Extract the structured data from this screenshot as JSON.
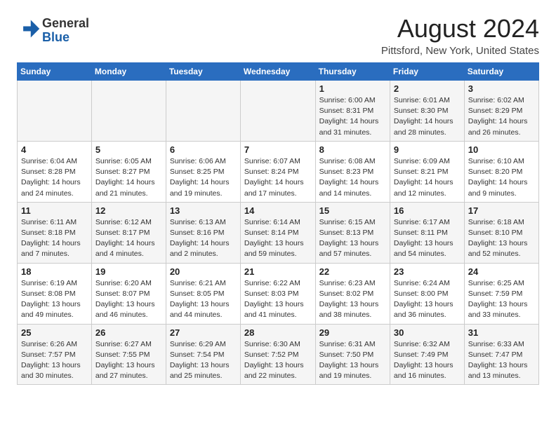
{
  "logo": {
    "general": "General",
    "blue": "Blue"
  },
  "title": "August 2024",
  "location": "Pittsford, New York, United States",
  "days_of_week": [
    "Sunday",
    "Monday",
    "Tuesday",
    "Wednesday",
    "Thursday",
    "Friday",
    "Saturday"
  ],
  "weeks": [
    [
      {
        "day": "",
        "info": ""
      },
      {
        "day": "",
        "info": ""
      },
      {
        "day": "",
        "info": ""
      },
      {
        "day": "",
        "info": ""
      },
      {
        "day": "1",
        "info": "Sunrise: 6:00 AM\nSunset: 8:31 PM\nDaylight: 14 hours and 31 minutes."
      },
      {
        "day": "2",
        "info": "Sunrise: 6:01 AM\nSunset: 8:30 PM\nDaylight: 14 hours and 28 minutes."
      },
      {
        "day": "3",
        "info": "Sunrise: 6:02 AM\nSunset: 8:29 PM\nDaylight: 14 hours and 26 minutes."
      }
    ],
    [
      {
        "day": "4",
        "info": "Sunrise: 6:04 AM\nSunset: 8:28 PM\nDaylight: 14 hours and 24 minutes."
      },
      {
        "day": "5",
        "info": "Sunrise: 6:05 AM\nSunset: 8:27 PM\nDaylight: 14 hours and 21 minutes."
      },
      {
        "day": "6",
        "info": "Sunrise: 6:06 AM\nSunset: 8:25 PM\nDaylight: 14 hours and 19 minutes."
      },
      {
        "day": "7",
        "info": "Sunrise: 6:07 AM\nSunset: 8:24 PM\nDaylight: 14 hours and 17 minutes."
      },
      {
        "day": "8",
        "info": "Sunrise: 6:08 AM\nSunset: 8:23 PM\nDaylight: 14 hours and 14 minutes."
      },
      {
        "day": "9",
        "info": "Sunrise: 6:09 AM\nSunset: 8:21 PM\nDaylight: 14 hours and 12 minutes."
      },
      {
        "day": "10",
        "info": "Sunrise: 6:10 AM\nSunset: 8:20 PM\nDaylight: 14 hours and 9 minutes."
      }
    ],
    [
      {
        "day": "11",
        "info": "Sunrise: 6:11 AM\nSunset: 8:18 PM\nDaylight: 14 hours and 7 minutes."
      },
      {
        "day": "12",
        "info": "Sunrise: 6:12 AM\nSunset: 8:17 PM\nDaylight: 14 hours and 4 minutes."
      },
      {
        "day": "13",
        "info": "Sunrise: 6:13 AM\nSunset: 8:16 PM\nDaylight: 14 hours and 2 minutes."
      },
      {
        "day": "14",
        "info": "Sunrise: 6:14 AM\nSunset: 8:14 PM\nDaylight: 13 hours and 59 minutes."
      },
      {
        "day": "15",
        "info": "Sunrise: 6:15 AM\nSunset: 8:13 PM\nDaylight: 13 hours and 57 minutes."
      },
      {
        "day": "16",
        "info": "Sunrise: 6:17 AM\nSunset: 8:11 PM\nDaylight: 13 hours and 54 minutes."
      },
      {
        "day": "17",
        "info": "Sunrise: 6:18 AM\nSunset: 8:10 PM\nDaylight: 13 hours and 52 minutes."
      }
    ],
    [
      {
        "day": "18",
        "info": "Sunrise: 6:19 AM\nSunset: 8:08 PM\nDaylight: 13 hours and 49 minutes."
      },
      {
        "day": "19",
        "info": "Sunrise: 6:20 AM\nSunset: 8:07 PM\nDaylight: 13 hours and 46 minutes."
      },
      {
        "day": "20",
        "info": "Sunrise: 6:21 AM\nSunset: 8:05 PM\nDaylight: 13 hours and 44 minutes."
      },
      {
        "day": "21",
        "info": "Sunrise: 6:22 AM\nSunset: 8:03 PM\nDaylight: 13 hours and 41 minutes."
      },
      {
        "day": "22",
        "info": "Sunrise: 6:23 AM\nSunset: 8:02 PM\nDaylight: 13 hours and 38 minutes."
      },
      {
        "day": "23",
        "info": "Sunrise: 6:24 AM\nSunset: 8:00 PM\nDaylight: 13 hours and 36 minutes."
      },
      {
        "day": "24",
        "info": "Sunrise: 6:25 AM\nSunset: 7:59 PM\nDaylight: 13 hours and 33 minutes."
      }
    ],
    [
      {
        "day": "25",
        "info": "Sunrise: 6:26 AM\nSunset: 7:57 PM\nDaylight: 13 hours and 30 minutes."
      },
      {
        "day": "26",
        "info": "Sunrise: 6:27 AM\nSunset: 7:55 PM\nDaylight: 13 hours and 27 minutes."
      },
      {
        "day": "27",
        "info": "Sunrise: 6:29 AM\nSunset: 7:54 PM\nDaylight: 13 hours and 25 minutes."
      },
      {
        "day": "28",
        "info": "Sunrise: 6:30 AM\nSunset: 7:52 PM\nDaylight: 13 hours and 22 minutes."
      },
      {
        "day": "29",
        "info": "Sunrise: 6:31 AM\nSunset: 7:50 PM\nDaylight: 13 hours and 19 minutes."
      },
      {
        "day": "30",
        "info": "Sunrise: 6:32 AM\nSunset: 7:49 PM\nDaylight: 13 hours and 16 minutes."
      },
      {
        "day": "31",
        "info": "Sunrise: 6:33 AM\nSunset: 7:47 PM\nDaylight: 13 hours and 13 minutes."
      }
    ]
  ]
}
